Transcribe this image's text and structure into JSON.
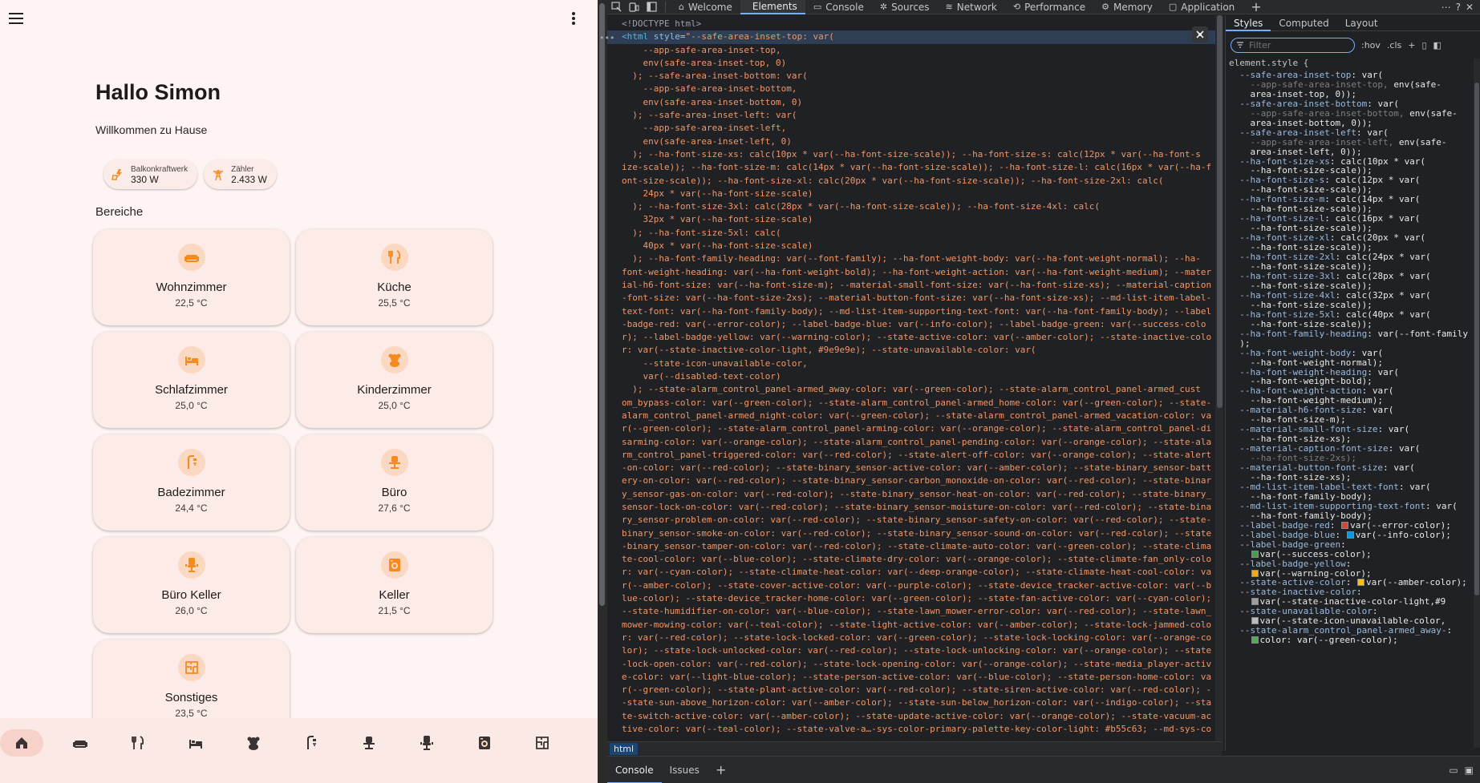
{
  "app": {
    "greeting": "Hallo Simon",
    "welcome": "Willkommen zu Hause",
    "badges": [
      {
        "label": "Balkonkraftwerk",
        "value": "330 W",
        "icon": "solar-power-icon"
      },
      {
        "label": "Zähler",
        "value": "2.433 W",
        "icon": "transmission-tower-icon"
      }
    ],
    "section_title": "Bereiche",
    "areas": [
      {
        "name": "Wohnzimmer",
        "temp": "22,5 °C",
        "icon": "sofa-icon"
      },
      {
        "name": "Küche",
        "temp": "25,5 °C",
        "icon": "fork-knife-icon"
      },
      {
        "name": "Schlafzimmer",
        "temp": "25,0 °C",
        "icon": "bed-icon"
      },
      {
        "name": "Kinderzimmer",
        "temp": "25,0 °C",
        "icon": "teddy-bear-icon"
      },
      {
        "name": "Badezimmer",
        "temp": "24,4 °C",
        "icon": "shower-icon"
      },
      {
        "name": "Büro",
        "temp": "27,6 °C",
        "icon": "desk-chair-icon"
      },
      {
        "name": "Büro Keller",
        "temp": "26,0 °C",
        "icon": "office-chair-icon"
      },
      {
        "name": "Keller",
        "temp": "21,5 °C",
        "icon": "washing-machine-icon"
      },
      {
        "name": "Sonstiges",
        "temp": "23,5 °C",
        "icon": "floor-plan-icon"
      }
    ],
    "nav_icons": [
      "home-icon",
      "sofa-icon",
      "fork-knife-icon",
      "bed-icon",
      "teddy-bear-icon",
      "shower-icon",
      "desk-chair-icon",
      "office-chair-icon",
      "washing-machine-icon",
      "floor-plan-icon"
    ],
    "colors": {
      "accent": "#f58b1f",
      "background": "#fdf4f3",
      "card": "#fcebe7",
      "icon_bg": "#fbd8c2"
    }
  },
  "devtools": {
    "tabs": [
      "Welcome",
      "Elements",
      "Console",
      "Sources",
      "Network",
      "Performance",
      "Memory",
      "Application"
    ],
    "active_tab": "Elements",
    "doctype": "<!DOCTYPE html>",
    "code_lines": [
      "<html style=\"--safe-area-inset-top: var(",
      "    --app-safe-area-inset-top,",
      "    env(safe-area-inset-top, 0)",
      "  ); --safe-area-inset-bottom: var(",
      "    --app-safe-area-inset-bottom,",
      "    env(safe-area-inset-bottom, 0)",
      "  ); --safe-area-inset-left: var(",
      "    --app-safe-area-inset-left,",
      "    env(safe-area-inset-left, 0)",
      "  ); --ha-font-size-xs: calc(10px * var(--ha-font-size-scale)); --ha-font-size-s: calc(12px * var(--ha-font-s",
      "ize-scale)); --ha-font-size-m: calc(14px * var(--ha-font-size-scale)); --ha-font-size-l: calc(16px * var(--ha-f",
      "ont-size-scale)); --ha-font-size-xl: calc(20px * var(--ha-font-size-scale)); --ha-font-size-2xl: calc(",
      "    24px * var(--ha-font-size-scale)",
      "  ); --ha-font-size-3xl: calc(28px * var(--ha-font-size-scale)); --ha-font-size-4xl: calc(",
      "    32px * var(--ha-font-size-scale)",
      "  ); --ha-font-size-5xl: calc(",
      "    40px * var(--ha-font-size-scale)",
      "  ); --ha-font-family-heading: var(--font-family); --ha-font-weight-body: var(--ha-font-weight-normal); --ha-",
      "font-weight-heading: var(--ha-font-weight-bold); --ha-font-weight-action: var(--ha-font-weight-medium); --mater",
      "ial-h6-font-size: var(--ha-font-size-m); --material-small-font-size: var(--ha-font-size-xs); --material-caption",
      "-font-size: var(--ha-font-size-2xs); --material-button-font-size: var(--ha-font-size-xs); --md-list-item-label-",
      "text-font: var(--ha-font-family-body); --md-list-item-supporting-text-font: var(--ha-font-family-body); --label",
      "-badge-red: var(--error-color); --label-badge-blue: var(--info-color); --label-badge-green: var(--success-colo",
      "r); --label-badge-yellow: var(--warning-color); --state-active-color: var(--amber-color); --state-inactive-colo",
      "r: var(--state-inactive-color-light, #9e9e9e); --state-unavailable-color: var(",
      "    --state-icon-unavailable-color,",
      "    var(--disabled-text-color)",
      "  ); --state-alarm_control_panel-armed_away-color: var(--green-color); --state-alarm_control_panel-armed_cust",
      "om_bypass-color: var(--green-color); --state-alarm_control_panel-armed_home-color: var(--green-color); --state-",
      "alarm_control_panel-armed_night-color: var(--green-color); --state-alarm_control_panel-armed_vacation-color: va",
      "r(--green-color); --state-alarm_control_panel-arming-color: var(--orange-color); --state-alarm_control_panel-di",
      "sarming-color: var(--orange-color); --state-alarm_control_panel-pending-color: var(--orange-color); --state-ala",
      "rm_control_panel-triggered-color: var(--red-color); --state-alert-off-color: var(--orange-color); --state-alert",
      "-on-color: var(--red-color); --state-binary_sensor-active-color: var(--amber-color); --state-binary_sensor-batt",
      "ery-on-color: var(--red-color); --state-binary_sensor-carbon_monoxide-on-color: var(--red-color); --state-binar",
      "y_sensor-gas-on-color: var(--red-color); --state-binary_sensor-heat-on-color: var(--red-color); --state-binary_",
      "sensor-lock-on-color: var(--red-color); --state-binary_sensor-moisture-on-color: var(--red-color); --state-bina",
      "ry_sensor-problem-on-color: var(--red-color); --state-binary_sensor-safety-on-color: var(--red-color); --state-",
      "binary_sensor-smoke-on-color: var(--red-color); --state-binary_sensor-sound-on-color: var(--red-color); --state",
      "-binary_sensor-tamper-on-color: var(--red-color); --state-climate-auto-color: var(--green-color); --state-clima",
      "te-cool-color: var(--blue-color); --state-climate-dry-color: var(--orange-color); --state-climate-fan_only-colo",
      "r: var(--cyan-color); --state-climate-heat-color: var(--deep-orange-color); --state-climate-heat-cool-color: va",
      "r(--amber-color); --state-cover-active-color: var(--purple-color); --state-device_tracker-active-color: var(--b",
      "lue-color); --state-device_tracker-home-color: var(--green-color); --state-fan-active-color: var(--cyan-color);",
      "--state-humidifier-on-color: var(--blue-color); --state-lawn_mower-error-color: var(--red-color); --state-lawn_",
      "mower-mowing-color: var(--teal-color); --state-light-active-color: var(--amber-color); --state-lock-jammed-colo",
      "r: var(--red-color); --state-lock-locked-color: var(--green-color); --state-lock-locking-color: var(--orange-co",
      "lor); --state-lock-unlocked-color: var(--red-color); --state-lock-unlocking-color: var(--orange-color); --state",
      "-lock-open-color: var(--red-color); --state-lock-opening-color: var(--orange-color); --state-media_player-activ",
      "e-color: var(--light-blue-color); --state-person-active-color: var(--blue-color); --state-person-home-color: va",
      "r(--green-color); --state-plant-active-color: var(--red-color); --state-siren-active-color: var(--red-color); -",
      "-state-sun-above_horizon-color: var(--amber-color); --state-sun-below_horizon-color: var(--indigo-color); --sta",
      "te-switch-active-color: var(--amber-color); --state-update-active-color: var(--orange-color); --state-vacuum-ac",
      "tive-color: var(--teal-color); --state-valve-a…-sys-color-primary-palette-key-color-light: #b55c63; --md-sys-co"
    ],
    "breadcrumb": "html",
    "styles_tabs": [
      "Styles",
      "Computed",
      "Layout"
    ],
    "filter_placeholder": "Filter",
    "hov": ":hov",
    "cls": ".cls",
    "rule_selector": "element.style {",
    "style_lines": [
      {
        "prop": "--safe-area-inset-top",
        "val": "var(",
        "dim": ""
      },
      {
        "prop": "",
        "val": "",
        "dim": "    --app-safe-area-inset-top, ",
        "tail": "env(safe-"
      },
      {
        "prop": "",
        "val": "    area-inset-top, 0));",
        "dim": ""
      },
      {
        "prop": "--safe-area-inset-bottom",
        "val": "var(",
        "dim": ""
      },
      {
        "prop": "",
        "val": "",
        "dim": "    --app-safe-area-inset-bottom, ",
        "tail": "env(safe-"
      },
      {
        "prop": "",
        "val": "    area-inset-bottom, 0));",
        "dim": ""
      },
      {
        "prop": "--safe-area-inset-left",
        "val": "var(",
        "dim": ""
      },
      {
        "prop": "",
        "val": "",
        "dim": "    --app-safe-area-inset-left, ",
        "tail": "env(safe-"
      },
      {
        "prop": "",
        "val": "    area-inset-left, 0));",
        "dim": ""
      },
      {
        "prop": "--ha-font-size-xs",
        "val": "calc(10px * var(",
        "dim": ""
      },
      {
        "prop": "",
        "val": "    --ha-font-size-scale));",
        "dim": ""
      },
      {
        "prop": "--ha-font-size-s",
        "val": "calc(12px * var(",
        "dim": ""
      },
      {
        "prop": "",
        "val": "    --ha-font-size-scale));",
        "dim": ""
      },
      {
        "prop": "--ha-font-size-m",
        "val": "calc(14px * var(",
        "dim": ""
      },
      {
        "prop": "",
        "val": "    --ha-font-size-scale));",
        "dim": ""
      },
      {
        "prop": "--ha-font-size-l",
        "val": "calc(16px * var(",
        "dim": ""
      },
      {
        "prop": "",
        "val": "    --ha-font-size-scale));",
        "dim": ""
      },
      {
        "prop": "--ha-font-size-xl",
        "val": "calc(20px * var(",
        "dim": ""
      },
      {
        "prop": "",
        "val": "    --ha-font-size-scale));",
        "dim": ""
      },
      {
        "prop": "--ha-font-size-2xl",
        "val": "calc(24px * var(",
        "dim": ""
      },
      {
        "prop": "",
        "val": "    --ha-font-size-scale));",
        "dim": ""
      },
      {
        "prop": "--ha-font-size-3xl",
        "val": "calc(28px * var(",
        "dim": ""
      },
      {
        "prop": "",
        "val": "    --ha-font-size-scale));",
        "dim": ""
      },
      {
        "prop": "--ha-font-size-4xl",
        "val": "calc(32px * var(",
        "dim": ""
      },
      {
        "prop": "",
        "val": "    --ha-font-size-scale));",
        "dim": ""
      },
      {
        "prop": "--ha-font-size-5xl",
        "val": "calc(40px * var(",
        "dim": ""
      },
      {
        "prop": "",
        "val": "    --ha-font-size-scale));",
        "dim": ""
      },
      {
        "prop": "--ha-font-family-heading",
        "val": "var(--font-family",
        "dim": ""
      },
      {
        "prop": "",
        "val": "  );",
        "dim": ""
      },
      {
        "prop": "--ha-font-weight-body",
        "val": "var(",
        "dim": ""
      },
      {
        "prop": "",
        "val": "    --ha-font-weight-normal);",
        "dim": ""
      },
      {
        "prop": "--ha-font-weight-heading",
        "val": "var(",
        "dim": ""
      },
      {
        "prop": "",
        "val": "    --ha-font-weight-bold);",
        "dim": ""
      },
      {
        "prop": "--ha-font-weight-action",
        "val": "var(",
        "dim": ""
      },
      {
        "prop": "",
        "val": "    --ha-font-weight-medium);",
        "dim": ""
      },
      {
        "prop": "--material-h6-font-size",
        "val": "var(",
        "dim": ""
      },
      {
        "prop": "",
        "val": "    --ha-font-size-m);",
        "dim": ""
      },
      {
        "prop": "--material-small-font-size",
        "val": "var(",
        "dim": ""
      },
      {
        "prop": "",
        "val": "    --ha-font-size-xs);",
        "dim": ""
      },
      {
        "prop": "--material-caption-font-size",
        "val": "var(",
        "dim": ""
      },
      {
        "prop": "",
        "val": "",
        "dim": "    --ha-font-size-2xs);"
      },
      {
        "prop": "--material-button-font-size",
        "val": "var(",
        "dim": ""
      },
      {
        "prop": "",
        "val": "    --ha-font-size-xs);",
        "dim": ""
      },
      {
        "prop": "--md-list-item-label-text-font",
        "val": "var(",
        "dim": ""
      },
      {
        "prop": "",
        "val": "    --ha-font-family-body);",
        "dim": ""
      },
      {
        "prop": "--md-list-item-supporting-text-font",
        "val": "var(",
        "dim": ""
      },
      {
        "prop": "",
        "val": "    --ha-font-family-body);",
        "dim": ""
      },
      {
        "prop": "--label-badge-red",
        "val": "var(--error-color);",
        "dim": "",
        "swatch": "#db4437"
      },
      {
        "prop": "--label-badge-blue",
        "val": "var(--info-color);",
        "dim": "",
        "swatch": "#039be5"
      },
      {
        "prop": "--label-badge-green",
        "val": "",
        "dim": ""
      },
      {
        "prop": "",
        "val": "  var(--success-color);",
        "dim": "",
        "swatch": "#43a047"
      },
      {
        "prop": "--label-badge-yellow",
        "val": "",
        "dim": ""
      },
      {
        "prop": "",
        "val": "  var(--warning-color);",
        "dim": "",
        "swatch": "#ffa600"
      },
      {
        "prop": "--state-active-color",
        "val": "var(--amber-color);",
        "dim": "",
        "swatch": "#ffc107"
      },
      {
        "prop": "--state-inactive-color",
        "val": "",
        "dim": ""
      },
      {
        "prop": "",
        "val": "  var(--state-inactive-color-light, ",
        "dim": "",
        "swatch": "#9e9e9e",
        "tail": "#9"
      },
      {
        "prop": "--state-unavailable-color",
        "val": "",
        "dim": ""
      },
      {
        "prop": "",
        "val": "  var(--state-icon-unavailable-color, ",
        "dim": "",
        "swatch": "#bdbdbd"
      },
      {
        "prop": "--state-alarm_control_panel-armed_away-",
        "val": "",
        "dim": ""
      },
      {
        "prop": "",
        "val": "  color: var(--green-color);",
        "dim": "",
        "swatch": "#4caf50"
      }
    ],
    "drawer_tabs": [
      "Console",
      "Issues"
    ]
  }
}
